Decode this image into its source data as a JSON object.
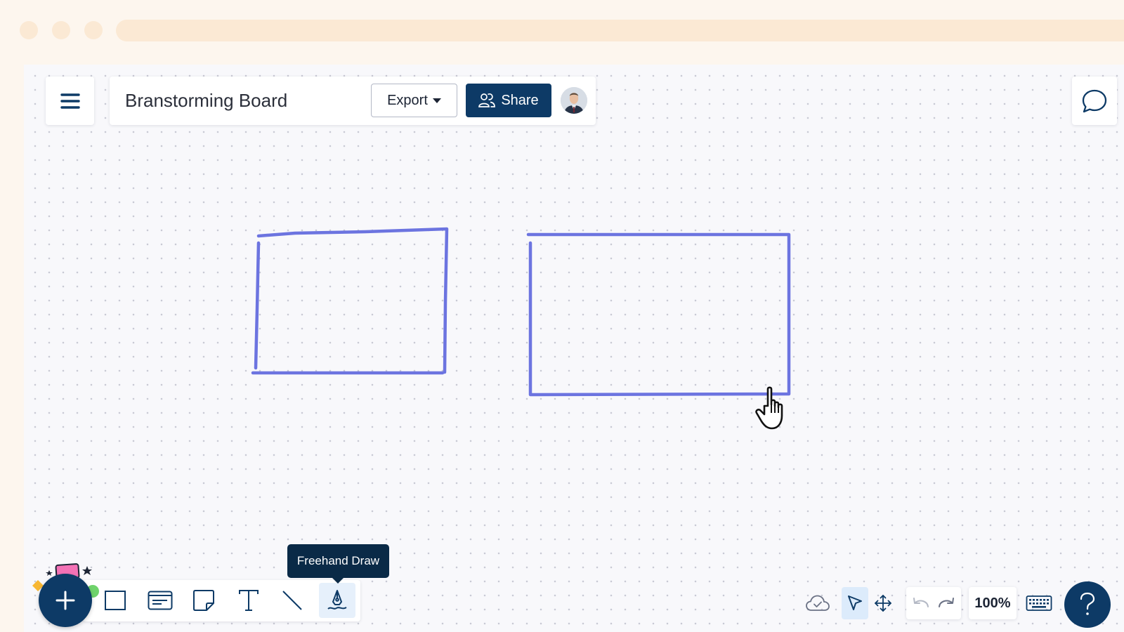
{
  "board": {
    "title": "Branstorming Board"
  },
  "header": {
    "export_label": "Export",
    "share_label": "Share"
  },
  "toolbar": {
    "tools": [
      {
        "name": "rectangle",
        "icon": "rectangle-icon"
      },
      {
        "name": "card",
        "icon": "card-icon"
      },
      {
        "name": "sticky-note",
        "icon": "sticky-note-icon"
      },
      {
        "name": "text",
        "icon": "text-icon"
      },
      {
        "name": "line",
        "icon": "line-icon"
      },
      {
        "name": "freehand-draw",
        "icon": "pen-icon",
        "active": true
      }
    ],
    "tooltip": "Freehand Draw"
  },
  "status": {
    "zoom": "100%"
  },
  "colors": {
    "brand": "#0d3a66",
    "stroke": "#6c74e0",
    "canvas": "#f8f8fb",
    "active_tool": "#e6f0fb"
  }
}
